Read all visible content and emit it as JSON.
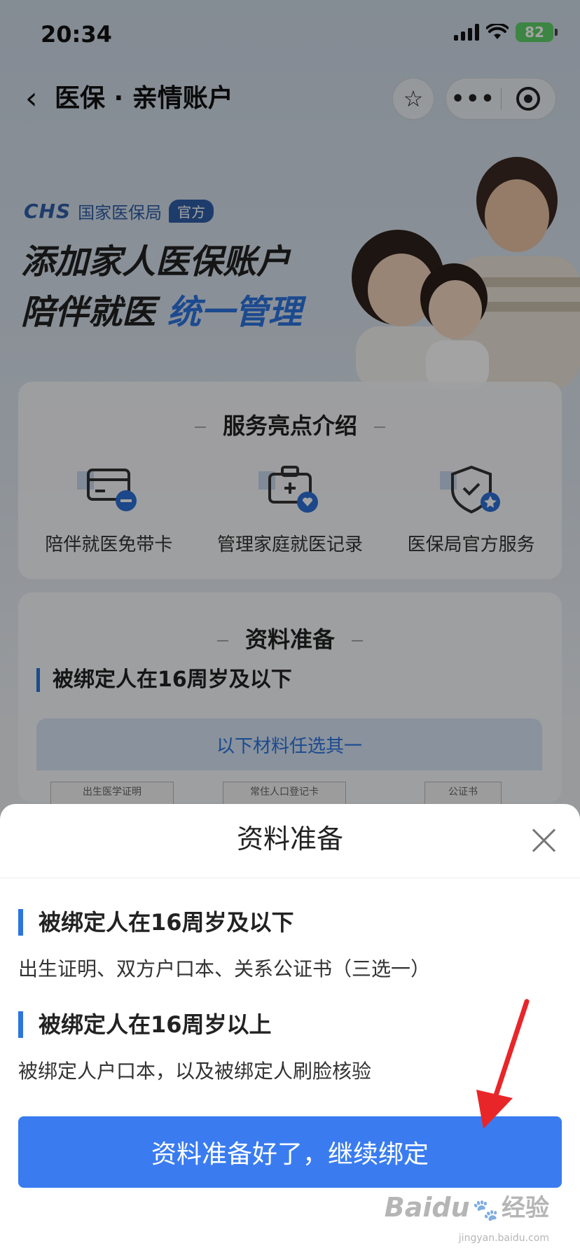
{
  "status_bar": {
    "time": "20:34",
    "battery": "82"
  },
  "nav": {
    "title": "医保 · 亲情账户"
  },
  "banner": {
    "logo_text": "CHS",
    "agency": "国家医保局",
    "badge": "官方",
    "headline_line1": "添加家人医保账户",
    "headline_line2_prefix": "陪伴就医 ",
    "headline_line2_highlight": "统一管理"
  },
  "highlights": {
    "title": "服务亮点介绍",
    "items": [
      {
        "label": "陪伴就医免带卡",
        "icon": "card-icon"
      },
      {
        "label": "管理家庭就医记录",
        "icon": "medical-kit-icon"
      },
      {
        "label": "医保局官方服务",
        "icon": "shield-icon"
      }
    ]
  },
  "materials_card": {
    "title": "资料准备",
    "section": "被绑定人在16周岁及以下",
    "options_title": "以下材料任选其一",
    "docs": [
      "出生医学证明",
      "常住人口登记卡",
      "公证书"
    ]
  },
  "sheet": {
    "title": "资料准备",
    "sections": [
      {
        "heading": "被绑定人在16周岁及以下",
        "text": "出生证明、双方户口本、关系公证书（三选一）"
      },
      {
        "heading": "被绑定人在16周岁以上",
        "text": "被绑定人户口本，以及被绑定人刷脸核验"
      }
    ],
    "cta": "资料准备好了，继续绑定"
  },
  "watermark": {
    "brand": "Baidu",
    "suffix": "经验",
    "url": "jingyan.baidu.com"
  },
  "colors": {
    "accent": "#3a7cf0",
    "annotation_arrow": "#e8262a",
    "battery": "#5fd068"
  }
}
